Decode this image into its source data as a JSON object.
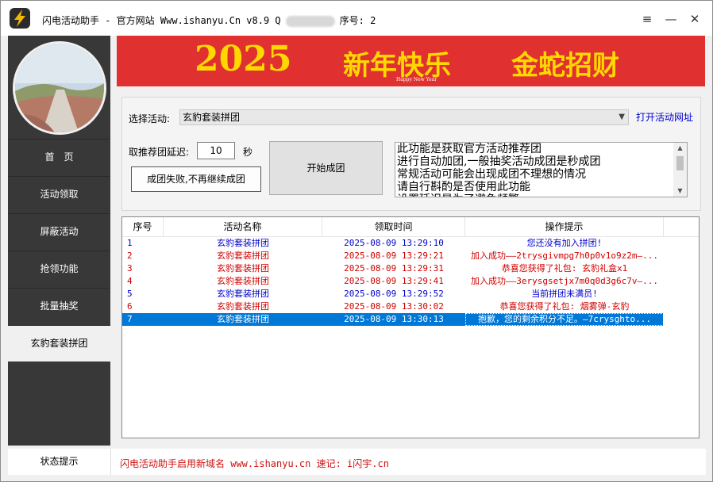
{
  "window": {
    "title_left": "闪电活动助手 - 官方网站  Www.ishanyu.Cn v8.9 Q",
    "title_right": "序号: 2",
    "menu_icon": "≡",
    "minimize_icon": "—",
    "close_icon": "✕"
  },
  "sidebar": {
    "items": [
      {
        "label": "首　页"
      },
      {
        "label": "活动领取"
      },
      {
        "label": "屏蔽活动"
      },
      {
        "label": "抢领功能"
      },
      {
        "label": "批量抽奖"
      },
      {
        "label": "玄豹套装拼团"
      }
    ],
    "active_index": 5
  },
  "banner": {
    "year": "2025",
    "greeting": "新年快乐",
    "subtext": "Happy New Year",
    "blessing": "金蛇招财"
  },
  "controls": {
    "activity_label": "选择活动:",
    "activity_value": "玄豹套装拼团",
    "open_link": "打开活动网址",
    "delay_label": "取推荐团延迟:",
    "delay_value": "10",
    "delay_unit": "秒",
    "fail_button": "成团失败,不再继续成团",
    "start_button": "开始成团",
    "description": "此功能是获取官方活动推荐团\n进行自动加团,一般抽奖活动成团是秒成团\n常规活动可能会出现成团不理想的情况\n请自行斟酌是否使用此功能\n设置延迟是为了避免频繁"
  },
  "table": {
    "headers": [
      "序号",
      "活动名称",
      "领取时间",
      "操作提示"
    ],
    "rows": [
      {
        "no": "1",
        "name": "玄豹套装拼团",
        "time": "2025-08-09 13:29:10",
        "tip": "您还没有加入拼团!",
        "color": "#0000c8"
      },
      {
        "no": "2",
        "name": "玄豹套装拼团",
        "time": "2025-08-09 13:29:21",
        "tip": "加入成功——2trysgivmpg7h0p0v1o9z2m—...",
        "color": "#d00000"
      },
      {
        "no": "3",
        "name": "玄豹套装拼团",
        "time": "2025-08-09 13:29:31",
        "tip": "恭喜您获得了礼包: 玄豹礼盒x1",
        "color": "#d00000"
      },
      {
        "no": "4",
        "name": "玄豹套装拼团",
        "time": "2025-08-09 13:29:41",
        "tip": "加入成功——3erysgsetjx7m0q0d3g6c7v—...",
        "color": "#d00000"
      },
      {
        "no": "5",
        "name": "玄豹套装拼团",
        "time": "2025-08-09 13:29:52",
        "tip": "当前拼团未满员!",
        "color": "#0000c8"
      },
      {
        "no": "6",
        "name": "玄豹套装拼团",
        "time": "2025-08-09 13:30:02",
        "tip": "恭喜您获得了礼包: 烟雾弹-玄豹",
        "color": "#d00000"
      },
      {
        "no": "7",
        "name": "玄豹套装拼团",
        "time": "2025-08-09 13:30:13",
        "tip": "抱歉，您的剩余积分不足。—7crysghto...",
        "color": "#ffffff"
      }
    ],
    "selected_row": "7"
  },
  "status": {
    "label": "状态提示",
    "text": "闪电活动助手启用新域名 www.ishanyu.cn 速记: i闪宇.cn"
  },
  "colors": {
    "sidebar_bg": "#383838",
    "banner_bg": "#e03030",
    "selection": "#0078d7",
    "link": "#0000d0",
    "status_text": "#d01010"
  }
}
